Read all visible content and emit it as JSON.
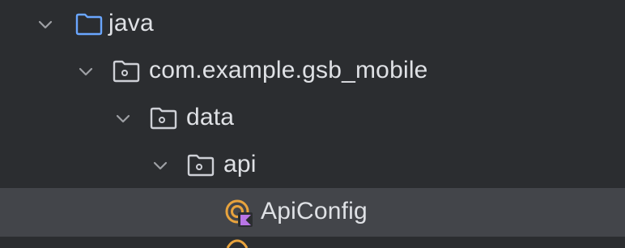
{
  "project_tree": {
    "rows": [
      {
        "label": "java",
        "expanded": true,
        "icon": "source-root-folder-icon"
      },
      {
        "label": "com.example.gsb_mobile",
        "expanded": true,
        "icon": "package-folder-icon"
      },
      {
        "label": "data",
        "expanded": true,
        "icon": "package-folder-icon"
      },
      {
        "label": "api",
        "expanded": true,
        "icon": "package-folder-icon"
      },
      {
        "label": "ApiConfig",
        "selected": true,
        "icon": "kotlin-object-icon"
      }
    ]
  },
  "colors": {
    "background": "#2b2d30",
    "selected_row": "#43454a",
    "text": "#dfe1e5",
    "chevron": "#9ea0a5",
    "source_folder": "#6aa6ff",
    "package_folder": "#ced0d6",
    "kotlin_accent": "#e8a33d",
    "kotlin_purple": "#b975e6"
  }
}
